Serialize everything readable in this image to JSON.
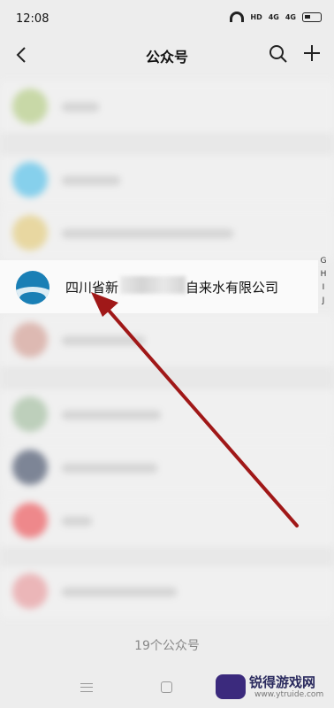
{
  "status": {
    "time": "12:08",
    "hd_label": "HD",
    "signal1": "4G",
    "signal2": "4G"
  },
  "nav": {
    "title": "公众号",
    "back_icon": "chevron-left-icon",
    "search_icon": "search-icon",
    "add_icon": "plus-icon"
  },
  "highlight": {
    "name_prefix": "四川省新",
    "name_suffix": "自来水有限公司"
  },
  "index_letters": [
    "G",
    "H",
    "I",
    "J"
  ],
  "count_text": "19个公众号",
  "watermark": {
    "brand": "锐得游戏网",
    "url": "www.ytruide.com"
  },
  "colors": {
    "arrow": "#a01818",
    "avatar_accent": "#1a7fb5"
  }
}
